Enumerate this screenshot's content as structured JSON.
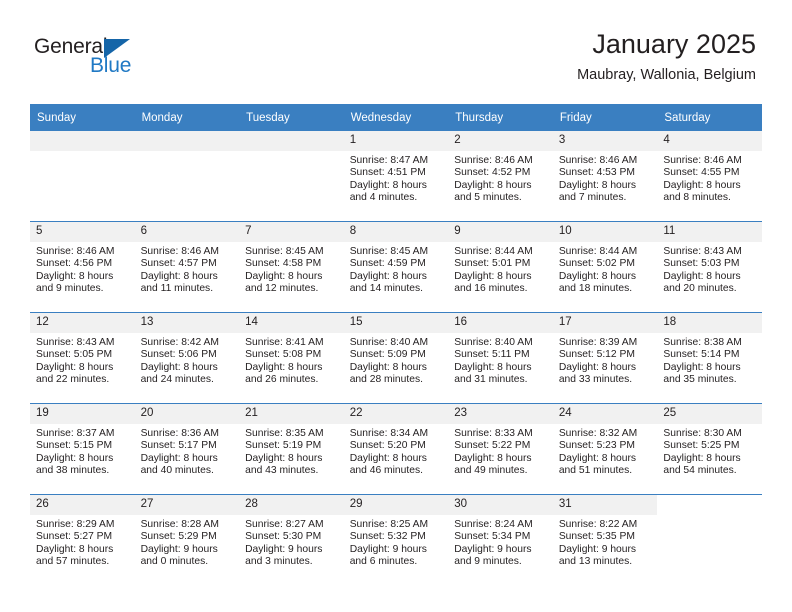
{
  "brand": {
    "name_top": "General",
    "name_bottom": "Blue",
    "triangle_icon": "triangle-logo-icon",
    "color_dark": "#231f20",
    "color_blue": "#2079c4"
  },
  "header": {
    "month_title": "January 2025",
    "location": "Maubray, Wallonia, Belgium"
  },
  "theme": {
    "header_bg": "#3a7fc1",
    "header_text": "#ffffff",
    "daynum_band_bg": "#f1f1f1",
    "cell_bg": "#ffffff",
    "grid_line": "#3a7fc1",
    "text": "#231f20"
  },
  "calendar": {
    "weekday_headers": [
      "Sunday",
      "Monday",
      "Tuesday",
      "Wednesday",
      "Thursday",
      "Friday",
      "Saturday"
    ],
    "weeks": [
      [
        {
          "day": "",
          "blank": true,
          "band": true
        },
        {
          "day": "",
          "blank": true,
          "band": true
        },
        {
          "day": "",
          "blank": true,
          "band": true
        },
        {
          "day": "1",
          "sunrise": "Sunrise: 8:47 AM",
          "sunset": "Sunset: 4:51 PM",
          "daylight_1": "Daylight: 8 hours",
          "daylight_2": "and 4 minutes."
        },
        {
          "day": "2",
          "sunrise": "Sunrise: 8:46 AM",
          "sunset": "Sunset: 4:52 PM",
          "daylight_1": "Daylight: 8 hours",
          "daylight_2": "and 5 minutes."
        },
        {
          "day": "3",
          "sunrise": "Sunrise: 8:46 AM",
          "sunset": "Sunset: 4:53 PM",
          "daylight_1": "Daylight: 8 hours",
          "daylight_2": "and 7 minutes."
        },
        {
          "day": "4",
          "sunrise": "Sunrise: 8:46 AM",
          "sunset": "Sunset: 4:55 PM",
          "daylight_1": "Daylight: 8 hours",
          "daylight_2": "and 8 minutes."
        }
      ],
      [
        {
          "day": "5",
          "sunrise": "Sunrise: 8:46 AM",
          "sunset": "Sunset: 4:56 PM",
          "daylight_1": "Daylight: 8 hours",
          "daylight_2": "and 9 minutes."
        },
        {
          "day": "6",
          "sunrise": "Sunrise: 8:46 AM",
          "sunset": "Sunset: 4:57 PM",
          "daylight_1": "Daylight: 8 hours",
          "daylight_2": "and 11 minutes."
        },
        {
          "day": "7",
          "sunrise": "Sunrise: 8:45 AM",
          "sunset": "Sunset: 4:58 PM",
          "daylight_1": "Daylight: 8 hours",
          "daylight_2": "and 12 minutes."
        },
        {
          "day": "8",
          "sunrise": "Sunrise: 8:45 AM",
          "sunset": "Sunset: 4:59 PM",
          "daylight_1": "Daylight: 8 hours",
          "daylight_2": "and 14 minutes."
        },
        {
          "day": "9",
          "sunrise": "Sunrise: 8:44 AM",
          "sunset": "Sunset: 5:01 PM",
          "daylight_1": "Daylight: 8 hours",
          "daylight_2": "and 16 minutes."
        },
        {
          "day": "10",
          "sunrise": "Sunrise: 8:44 AM",
          "sunset": "Sunset: 5:02 PM",
          "daylight_1": "Daylight: 8 hours",
          "daylight_2": "and 18 minutes."
        },
        {
          "day": "11",
          "sunrise": "Sunrise: 8:43 AM",
          "sunset": "Sunset: 5:03 PM",
          "daylight_1": "Daylight: 8 hours",
          "daylight_2": "and 20 minutes."
        }
      ],
      [
        {
          "day": "12",
          "sunrise": "Sunrise: 8:43 AM",
          "sunset": "Sunset: 5:05 PM",
          "daylight_1": "Daylight: 8 hours",
          "daylight_2": "and 22 minutes."
        },
        {
          "day": "13",
          "sunrise": "Sunrise: 8:42 AM",
          "sunset": "Sunset: 5:06 PM",
          "daylight_1": "Daylight: 8 hours",
          "daylight_2": "and 24 minutes."
        },
        {
          "day": "14",
          "sunrise": "Sunrise: 8:41 AM",
          "sunset": "Sunset: 5:08 PM",
          "daylight_1": "Daylight: 8 hours",
          "daylight_2": "and 26 minutes."
        },
        {
          "day": "15",
          "sunrise": "Sunrise: 8:40 AM",
          "sunset": "Sunset: 5:09 PM",
          "daylight_1": "Daylight: 8 hours",
          "daylight_2": "and 28 minutes."
        },
        {
          "day": "16",
          "sunrise": "Sunrise: 8:40 AM",
          "sunset": "Sunset: 5:11 PM",
          "daylight_1": "Daylight: 8 hours",
          "daylight_2": "and 31 minutes."
        },
        {
          "day": "17",
          "sunrise": "Sunrise: 8:39 AM",
          "sunset": "Sunset: 5:12 PM",
          "daylight_1": "Daylight: 8 hours",
          "daylight_2": "and 33 minutes."
        },
        {
          "day": "18",
          "sunrise": "Sunrise: 8:38 AM",
          "sunset": "Sunset: 5:14 PM",
          "daylight_1": "Daylight: 8 hours",
          "daylight_2": "and 35 minutes."
        }
      ],
      [
        {
          "day": "19",
          "sunrise": "Sunrise: 8:37 AM",
          "sunset": "Sunset: 5:15 PM",
          "daylight_1": "Daylight: 8 hours",
          "daylight_2": "and 38 minutes."
        },
        {
          "day": "20",
          "sunrise": "Sunrise: 8:36 AM",
          "sunset": "Sunset: 5:17 PM",
          "daylight_1": "Daylight: 8 hours",
          "daylight_2": "and 40 minutes."
        },
        {
          "day": "21",
          "sunrise": "Sunrise: 8:35 AM",
          "sunset": "Sunset: 5:19 PM",
          "daylight_1": "Daylight: 8 hours",
          "daylight_2": "and 43 minutes."
        },
        {
          "day": "22",
          "sunrise": "Sunrise: 8:34 AM",
          "sunset": "Sunset: 5:20 PM",
          "daylight_1": "Daylight: 8 hours",
          "daylight_2": "and 46 minutes."
        },
        {
          "day": "23",
          "sunrise": "Sunrise: 8:33 AM",
          "sunset": "Sunset: 5:22 PM",
          "daylight_1": "Daylight: 8 hours",
          "daylight_2": "and 49 minutes."
        },
        {
          "day": "24",
          "sunrise": "Sunrise: 8:32 AM",
          "sunset": "Sunset: 5:23 PM",
          "daylight_1": "Daylight: 8 hours",
          "daylight_2": "and 51 minutes."
        },
        {
          "day": "25",
          "sunrise": "Sunrise: 8:30 AM",
          "sunset": "Sunset: 5:25 PM",
          "daylight_1": "Daylight: 8 hours",
          "daylight_2": "and 54 minutes."
        }
      ],
      [
        {
          "day": "26",
          "sunrise": "Sunrise: 8:29 AM",
          "sunset": "Sunset: 5:27 PM",
          "daylight_1": "Daylight: 8 hours",
          "daylight_2": "and 57 minutes."
        },
        {
          "day": "27",
          "sunrise": "Sunrise: 8:28 AM",
          "sunset": "Sunset: 5:29 PM",
          "daylight_1": "Daylight: 9 hours",
          "daylight_2": "and 0 minutes."
        },
        {
          "day": "28",
          "sunrise": "Sunrise: 8:27 AM",
          "sunset": "Sunset: 5:30 PM",
          "daylight_1": "Daylight: 9 hours",
          "daylight_2": "and 3 minutes."
        },
        {
          "day": "29",
          "sunrise": "Sunrise: 8:25 AM",
          "sunset": "Sunset: 5:32 PM",
          "daylight_1": "Daylight: 9 hours",
          "daylight_2": "and 6 minutes."
        },
        {
          "day": "30",
          "sunrise": "Sunrise: 8:24 AM",
          "sunset": "Sunset: 5:34 PM",
          "daylight_1": "Daylight: 9 hours",
          "daylight_2": "and 9 minutes."
        },
        {
          "day": "31",
          "sunrise": "Sunrise: 8:22 AM",
          "sunset": "Sunset: 5:35 PM",
          "daylight_1": "Daylight: 9 hours",
          "daylight_2": "and 13 minutes."
        },
        {
          "day": "",
          "blank": true,
          "band": false
        }
      ]
    ]
  }
}
